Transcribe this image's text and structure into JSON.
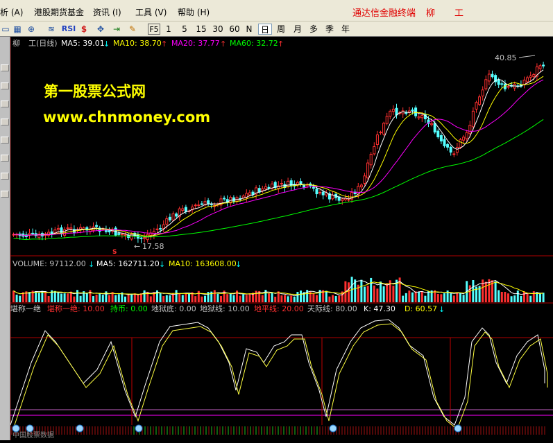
{
  "menubar": {
    "items": [
      "析 (A)",
      "港股期货基金",
      "资讯 (I)",
      "工具 (V)",
      "帮助 (H)"
    ],
    "brand": "通达信金融终端",
    "stock_short": "柳",
    "stock_name": "工"
  },
  "toolbar": {
    "periods": [
      "F5",
      "1",
      "5",
      "15",
      "30",
      "60",
      "N",
      "日",
      "周",
      "月",
      "多",
      "季",
      "年"
    ],
    "active_period": "日",
    "icons": [
      "window-icon",
      "grid-icon",
      "zoom-icon",
      "chart-icon",
      "rsi-icon",
      "dollar-icon",
      "move-icon",
      "export-icon",
      "pen-icon"
    ],
    "rsi_label": "RSI"
  },
  "price_panel": {
    "symbol": "柳",
    "title": "工(日线)",
    "ma5": "MA5: 39.01",
    "ma10": "MA10: 38.70",
    "ma20": "MA20: 37.77",
    "ma60": "MA60: 32.72",
    "high_label": "40.85",
    "low_label": "17.58",
    "marker": "S",
    "colors": {
      "ma5": "#ffffff",
      "ma10": "#ffff00",
      "ma20": "#ff00ff",
      "ma60": "#00ff00",
      "up": "#ff3030",
      "down": "#54ffff"
    }
  },
  "volume_panel": {
    "volume": "VOLUME: 97112.00",
    "ma5": "MA5: 162711.20",
    "ma10": "MA10: 163608.00"
  },
  "indicator_panel": {
    "name": "堪称一绝",
    "p1_label": "堪称一绝: 10.00",
    "p2_label": "持币: 0.00",
    "p3_label": "地狱底: 0.00",
    "p4_label": "地狱线: 10.00",
    "p5_label": "地平线: 20.00",
    "p6_label": "天际线: 80.00",
    "k_label": "K: 47.30",
    "d_label": "D: 60.57",
    "footer": "中国股票数据"
  },
  "watermark": {
    "line1": "第一股票公式网",
    "line2": "www.chnmoney.com"
  }
}
